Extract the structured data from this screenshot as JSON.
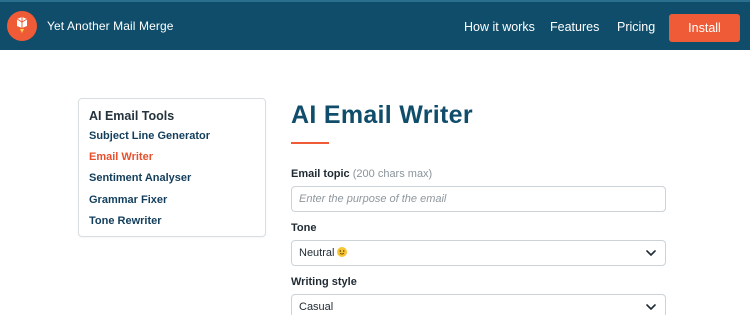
{
  "header": {
    "brand_name": "Yet Another Mail Merge",
    "nav": [
      {
        "label": "How it works"
      },
      {
        "label": "Features"
      },
      {
        "label": "Pricing"
      }
    ],
    "install_label": "Install"
  },
  "sidebar": {
    "title": "AI Email Tools",
    "items": [
      {
        "label": "Subject Line Generator",
        "active": false
      },
      {
        "label": "Email Writer",
        "active": true
      },
      {
        "label": "Sentiment Analyser",
        "active": false
      },
      {
        "label": "Grammar Fixer",
        "active": false
      },
      {
        "label": "Tone Rewriter",
        "active": false
      }
    ]
  },
  "main": {
    "title": "AI Email Writer",
    "email_topic": {
      "label": "Email topic",
      "hint": "(200 chars max)",
      "value": "",
      "placeholder": "Enter the purpose of the email"
    },
    "tone": {
      "label": "Tone",
      "value": "Neutral",
      "icon": "slightly-smiling-face-emoji"
    },
    "writing_style": {
      "label": "Writing style",
      "value": "Casual"
    }
  },
  "colors": {
    "header_bg": "#0f4d6b",
    "accent": "#ef5b37",
    "link": "#123e5c",
    "active_link": "#e8502d",
    "title": "#0f4d6b"
  }
}
